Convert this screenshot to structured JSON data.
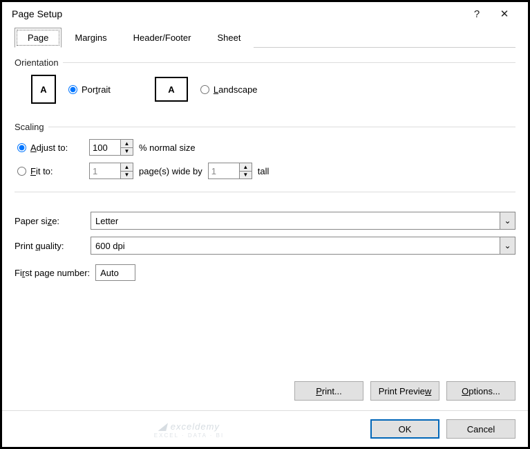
{
  "title": "Page Setup",
  "titlebar": {
    "help": "?",
    "close": "✕"
  },
  "tabs": [
    "Page",
    "Margins",
    "Header/Footer",
    "Sheet"
  ],
  "orientation": {
    "label": "Orientation",
    "portrait": "Portrait",
    "landscape": "Landscape",
    "icon_letter": "A"
  },
  "scaling": {
    "label": "Scaling",
    "adjust_label": "Adjust to:",
    "adjust_value": "100",
    "adjust_suffix": "% normal size",
    "fit_label": "Fit to:",
    "fit_wide": "1",
    "fit_mid": "page(s) wide by",
    "fit_tall_value": "1",
    "fit_tall_suffix": "tall"
  },
  "paper": {
    "label": "Paper size:",
    "value": "Letter"
  },
  "quality": {
    "label": "Print quality:",
    "value": "600 dpi"
  },
  "firstpage": {
    "label": "First page number:",
    "value": "Auto"
  },
  "buttons": {
    "print": "Print...",
    "preview": "Print Preview",
    "options": "Options...",
    "ok": "OK",
    "cancel": "Cancel"
  },
  "watermark": {
    "main": "exceldemy",
    "sub": "EXCEL · DATA · BI"
  }
}
